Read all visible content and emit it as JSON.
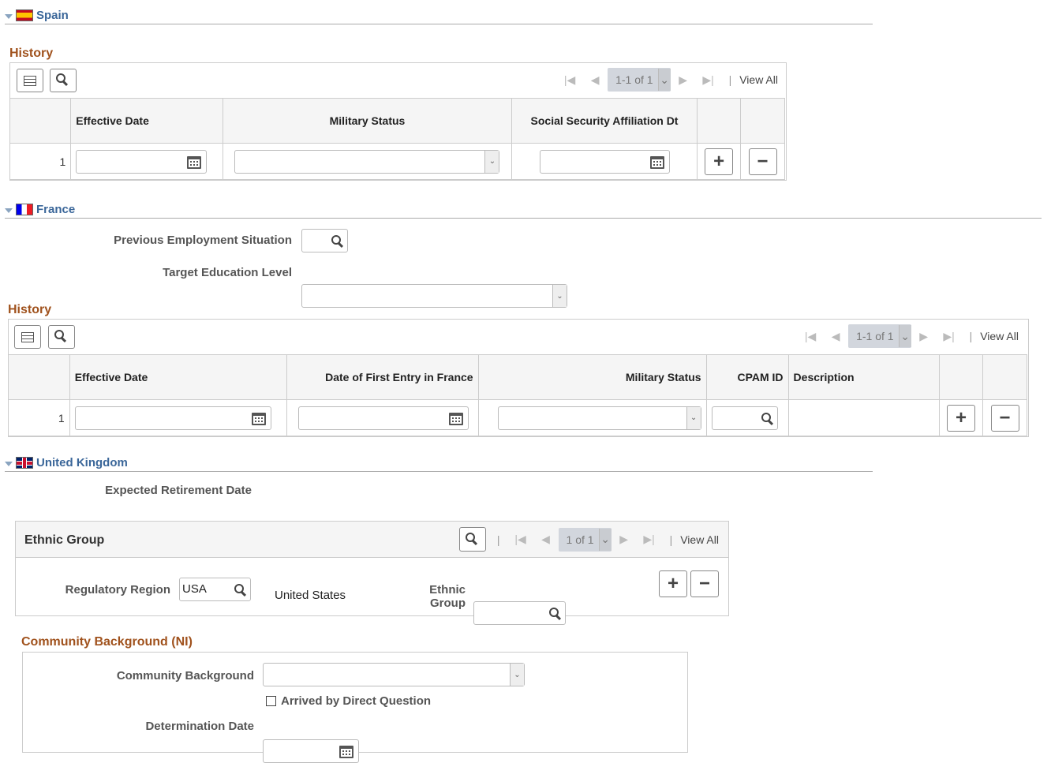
{
  "spain": {
    "title": "Spain",
    "history_title": "History",
    "nav": {
      "page": "1-1 of 1",
      "view_all": "View All"
    },
    "columns": [
      "Effective Date",
      "Military Status",
      "Social Security Affiliation Dt"
    ],
    "rows": [
      {
        "num": "1",
        "effective_date": "",
        "military_status": "",
        "ss_affiliation_dt": ""
      }
    ]
  },
  "france": {
    "title": "France",
    "prev_employment_label": "Previous Employment Situation",
    "prev_employment_value": "",
    "target_education_label": "Target Education Level",
    "target_education_value": "",
    "history_title": "History",
    "nav": {
      "page": "1-1 of 1",
      "view_all": "View All"
    },
    "columns": [
      "Effective Date",
      "Date of First Entry in France",
      "Military Status",
      "CPAM ID",
      "Description"
    ],
    "rows": [
      {
        "num": "1",
        "effective_date": "",
        "first_entry": "",
        "military_status": "",
        "cpam_id": "",
        "description": ""
      }
    ]
  },
  "uk": {
    "title": "United Kingdom",
    "expected_retirement_label": "Expected Retirement Date",
    "expected_retirement_value": "",
    "ethnic": {
      "title": "Ethnic Group",
      "nav": {
        "page": "1 of 1",
        "view_all": "View All"
      },
      "regulatory_region_label": "Regulatory Region",
      "regulatory_region_value": "USA",
      "region_desc": "United States",
      "ethnic_group_label": "Ethnic Group",
      "ethnic_group_value": ""
    },
    "community": {
      "title": "Community Background (NI)",
      "background_label": "Community Background",
      "background_value": "",
      "direct_question_label": "Arrived by Direct Question",
      "direct_question_checked": false,
      "determination_label": "Determination Date",
      "determination_value": ""
    }
  }
}
